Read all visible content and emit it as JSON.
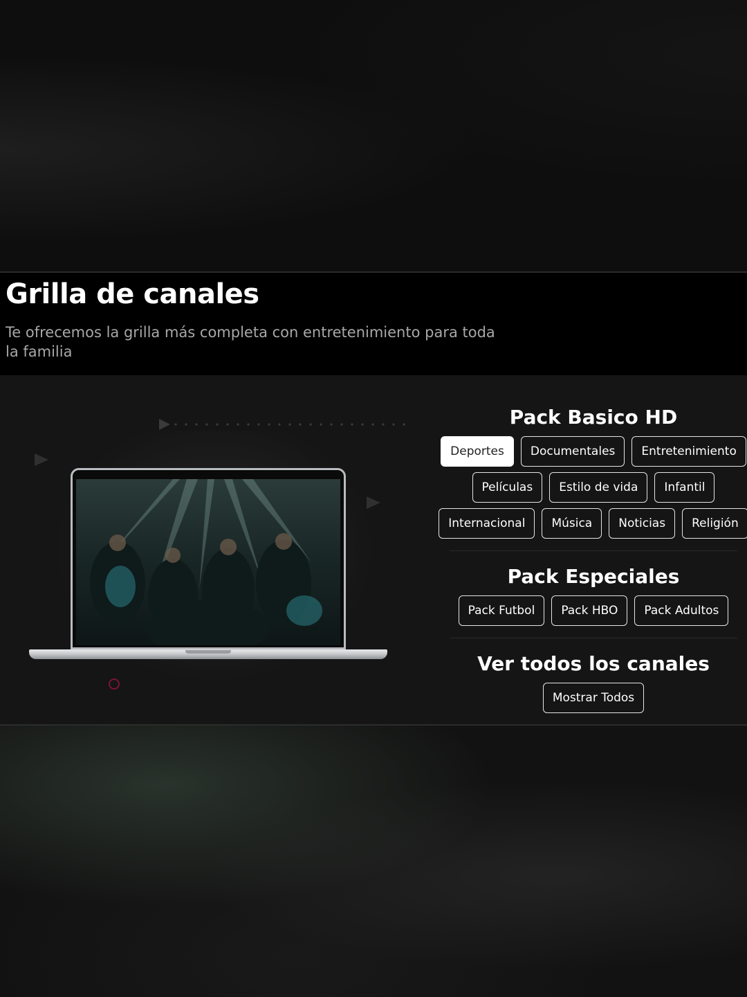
{
  "header": {
    "title": "Grilla de canales",
    "subtitle": "Te ofrecemos la grilla más completa con entretenimiento para toda la familia"
  },
  "illustration": {
    "device_icon": "laptop-icon",
    "accent_color": "#c2185b"
  },
  "packs": {
    "basic": {
      "title": "Pack Basico HD",
      "active_index": 0,
      "rows": [
        [
          "Deportes",
          "Documentales",
          "Entretenimiento"
        ],
        [
          "Películas",
          "Estilo de vida",
          "Infantil"
        ],
        [
          "Internacional",
          "Música",
          "Noticias",
          "Religión"
        ]
      ]
    },
    "special": {
      "title": "Pack Especiales",
      "items": [
        "Pack Futbol",
        "Pack HBO",
        "Pack Adultos"
      ]
    },
    "all": {
      "title": "Ver todos los canales",
      "button_label": "Mostrar Todos"
    }
  }
}
